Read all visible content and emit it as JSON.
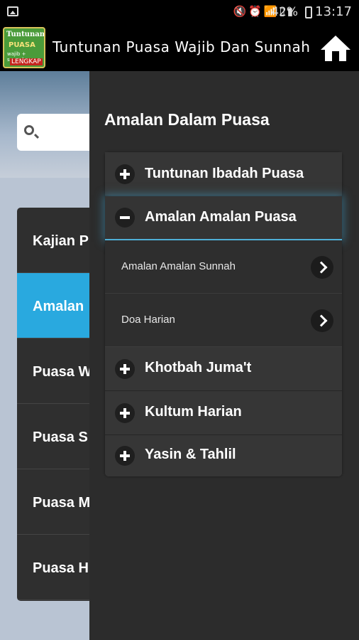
{
  "status_bar": {
    "battery": "42%",
    "time": "13:17",
    "icons": [
      "image-icon",
      "mute-icon",
      "alarm-icon",
      "wifi-icon",
      "sim-icon",
      "signal-icon",
      "battery-icon"
    ]
  },
  "app_bar": {
    "logo_lines": [
      "Tuntunan",
      "PUASA",
      "wajib + sunnah",
      "LENGKAP"
    ],
    "title": "Tuntunan Puasa Wajib Dan Sunnah",
    "home_icon": "home-icon"
  },
  "background": {
    "list_items": [
      {
        "label": "Kajian P"
      },
      {
        "label": "Amalan"
      },
      {
        "label": "Puasa W"
      },
      {
        "label": "Puasa S"
      },
      {
        "label": "Puasa M"
      },
      {
        "label": "Puasa H"
      }
    ],
    "active_index": 1
  },
  "drawer": {
    "title": "Amalan Dalam Puasa",
    "groups": [
      {
        "label": "Tuntunan Ibadah Puasa",
        "icon": "plus-icon",
        "expanded": false
      },
      {
        "label": "Amalan Amalan Puasa",
        "icon": "minus-icon",
        "expanded": true,
        "children": [
          {
            "label": "Amalan Amalan Sunnah"
          },
          {
            "label": "Doa Harian"
          }
        ]
      },
      {
        "label": "Khotbah Juma't",
        "icon": "plus-icon",
        "expanded": false
      },
      {
        "label": "Kultum Harian",
        "icon": "plus-icon",
        "expanded": false
      },
      {
        "label": "Yasin & Tahlil",
        "icon": "plus-icon",
        "expanded": false
      }
    ]
  },
  "colors": {
    "accent_blue": "#29a9df",
    "drawer_bg": "#2c2c2c",
    "appbar_bg": "#000000"
  }
}
